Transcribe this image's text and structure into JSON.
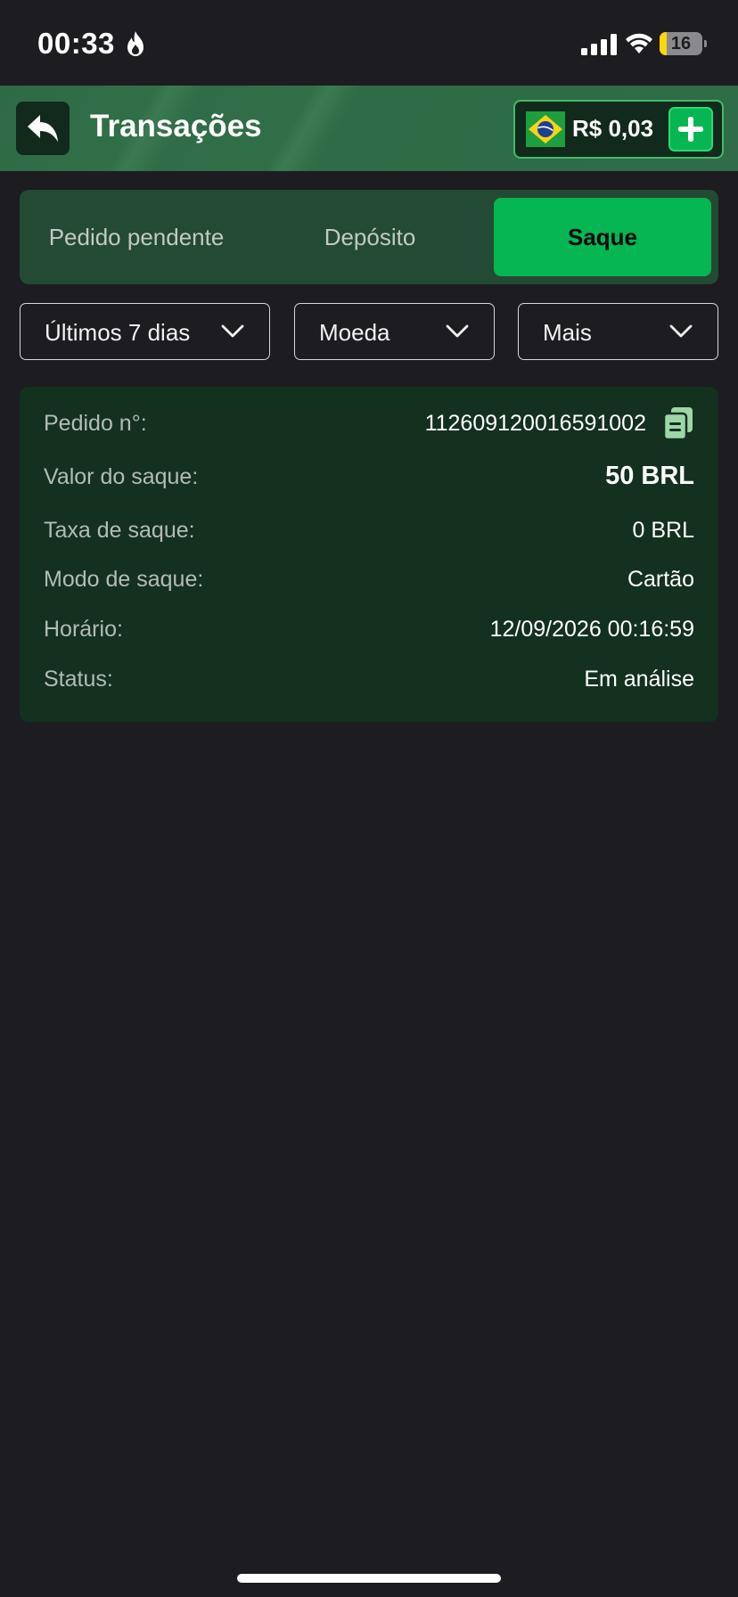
{
  "status_bar": {
    "time": "00:33",
    "battery": "16",
    "battery_level": 0.16
  },
  "header": {
    "title": "Transações",
    "balance": "R$ 0,03",
    "back_icon": "reply-arrow-icon",
    "flag_icon": "brazil-flag-icon",
    "add_icon": "plus-icon",
    "accent_color": "#05b653"
  },
  "tabs": [
    {
      "label": "Pedido pendente",
      "active": false
    },
    {
      "label": "Depósito",
      "active": false
    },
    {
      "label": "Saque",
      "active": true
    }
  ],
  "filters": [
    {
      "label": "Últimos 7 dias"
    },
    {
      "label": "Moeda"
    },
    {
      "label": "Mais"
    }
  ],
  "transaction": {
    "rows": [
      {
        "label": "Pedido n°:",
        "value": "112609120016591002"
      },
      {
        "label": "Valor do saque:",
        "value": "50 BRL"
      },
      {
        "label": "Taxa de saque:",
        "value": "0 BRL"
      },
      {
        "label": "Modo de saque:",
        "value": "Cartão"
      },
      {
        "label": "Horário:",
        "value": "12/09/2026 00:16:59"
      },
      {
        "label": "Status:",
        "value": "Em análise"
      }
    ]
  }
}
